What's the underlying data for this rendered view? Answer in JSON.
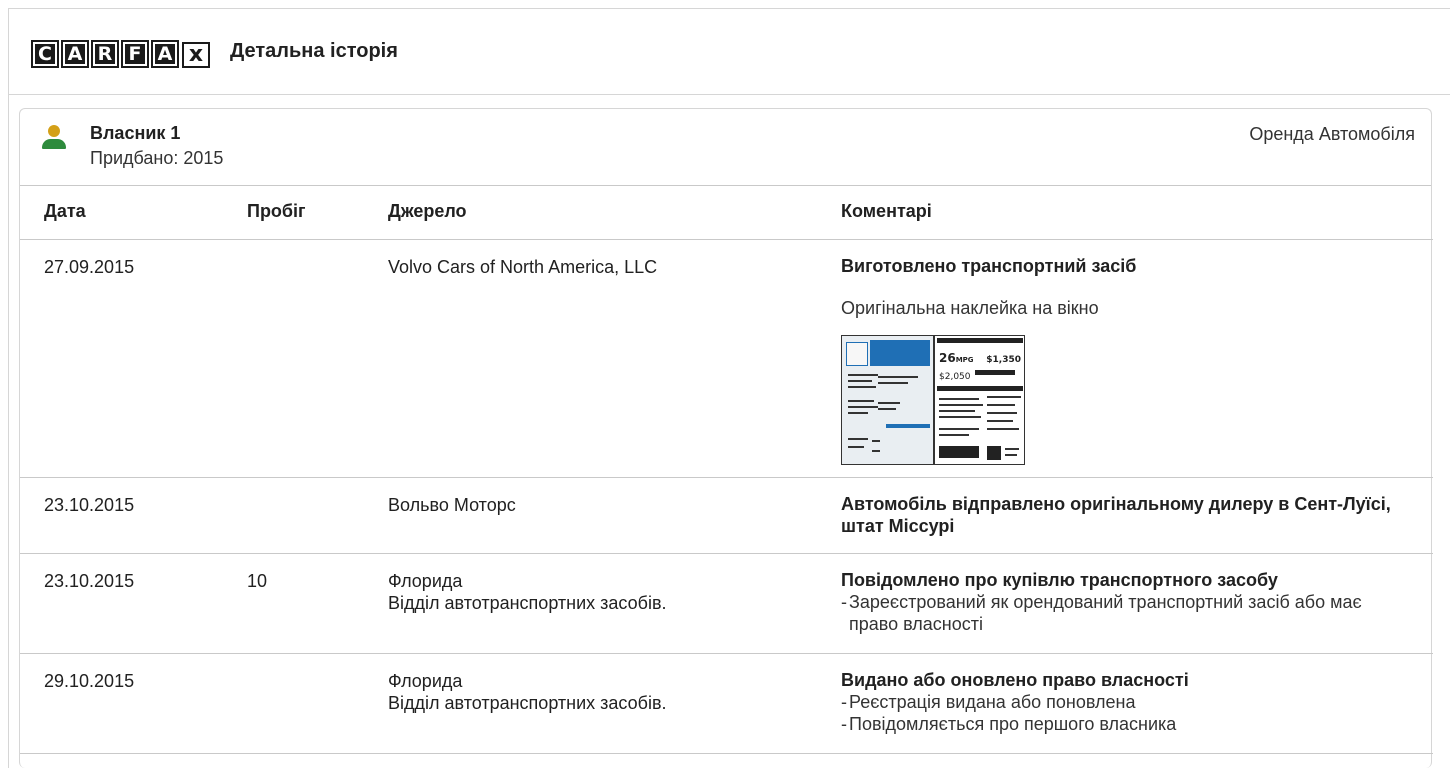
{
  "header": {
    "logo_letters": [
      "C",
      "A",
      "R",
      "F",
      "A",
      "x"
    ],
    "title": "Детальна історія"
  },
  "owner": {
    "name": "Власник 1",
    "purchased": "Придбано: 2015",
    "usage": "Оренда Автомобіля",
    "icon": "person-icon",
    "colors": {
      "head": "#d4a017",
      "body": "#2e8b3d"
    }
  },
  "table": {
    "headers": [
      "Дата",
      "Пробіг",
      "Джерело",
      "Коментарі"
    ],
    "rows": [
      {
        "date": "27.09.2015",
        "mileage": "",
        "source": [
          "Volvo Cars of North America, LLC"
        ],
        "title": "Виготовлено транспортний засіб",
        "sub": "Оригінальна наклейка на вікно",
        "sticker": {
          "mpg": "26",
          "mpg_unit": "MPG",
          "save": "$1,350",
          "cost": "$2,050"
        },
        "lines": []
      },
      {
        "date": "23.10.2015",
        "mileage": "",
        "source": [
          "Вольво Моторс"
        ],
        "title": "Автомобіль відправлено оригінальному дилеру в Сент-Луїсі, штат Міссурі",
        "lines": []
      },
      {
        "date": "23.10.2015",
        "mileage": "10",
        "source": [
          "Флорида",
          "Відділ автотранспортних засобів."
        ],
        "title": "Повідомлено про купівлю транспортного засобу",
        "lines": [
          "Зареєстрований як орендований транспортний засіб або має право власності"
        ]
      },
      {
        "date": "29.10.2015",
        "mileage": "",
        "source": [
          "Флорида",
          "Відділ автотранспортних засобів."
        ],
        "title": "Видано або оновлено право власності",
        "lines": [
          "Реєстрація видана або поновлена",
          "Повідомляється про першого власника"
        ]
      }
    ]
  }
}
